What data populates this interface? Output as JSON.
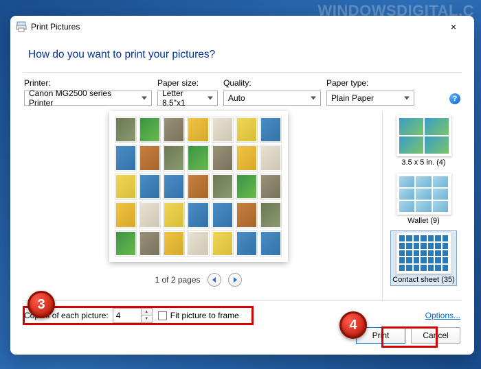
{
  "watermark": "WINDOWSDIGITAL.C",
  "dialog": {
    "title": "Print Pictures",
    "heading": "How do you want to print your pictures?",
    "close_label": "×"
  },
  "controls": {
    "printer": {
      "label": "Printer:",
      "value": "Canon MG2500 series Printer"
    },
    "paper_size": {
      "label": "Paper size:",
      "value": "Letter 8.5\"x1"
    },
    "quality": {
      "label": "Quality:",
      "value": "Auto"
    },
    "paper_type": {
      "label": "Paper type:",
      "value": "Plain Paper"
    },
    "help": "?"
  },
  "pager": {
    "text": "1 of 2 pages"
  },
  "layouts": [
    {
      "label": "3.5 x 5 in. (4)",
      "selected": false
    },
    {
      "label": "Wallet (9)",
      "selected": false
    },
    {
      "label": "Contact sheet (35)",
      "selected": true
    }
  ],
  "bottom": {
    "copies_label": "Copies of each picture:",
    "copies_value": "4",
    "fit_label": "Fit picture to frame",
    "fit_checked": false,
    "options_label": "Options..."
  },
  "buttons": {
    "print": "Print",
    "cancel": "Cancel"
  },
  "annotations": {
    "badge3": "3",
    "badge4": "4"
  }
}
